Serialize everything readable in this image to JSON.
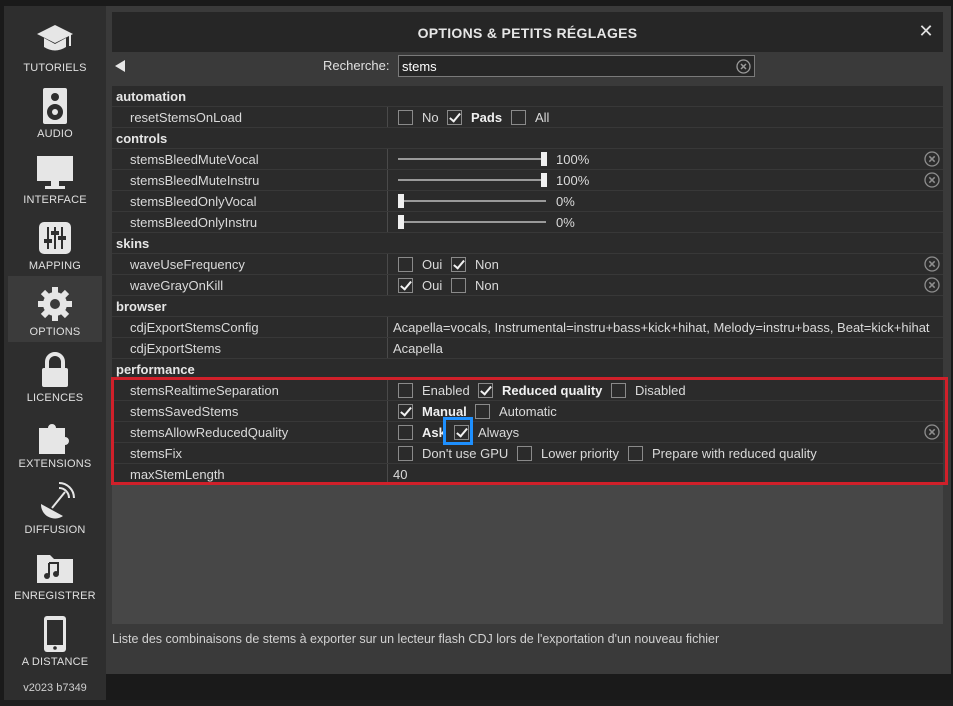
{
  "sidebar": {
    "items": [
      {
        "label": "TUTORIELS",
        "icon": "graduation-cap-icon"
      },
      {
        "label": "AUDIO",
        "icon": "speaker-icon"
      },
      {
        "label": "INTERFACE",
        "icon": "monitor-icon"
      },
      {
        "label": "MAPPING",
        "icon": "sliders-icon"
      },
      {
        "label": "OPTIONS",
        "icon": "gear-icon",
        "active": true
      },
      {
        "label": "LICENCES",
        "icon": "lock-icon"
      },
      {
        "label": "EXTENSIONS",
        "icon": "puzzle-icon"
      },
      {
        "label": "DIFFUSION",
        "icon": "broadcast-icon"
      },
      {
        "label": "ENREGISTRER",
        "icon": "music-folder-icon"
      },
      {
        "label": "A DISTANCE",
        "icon": "phone-icon"
      }
    ],
    "version": "v2023 b7349"
  },
  "dialog": {
    "title": "OPTIONS & PETITS RÉGLAGES",
    "close": "✕",
    "search_label": "Recherche:",
    "search_value": "stems"
  },
  "table": {
    "automation": "automation",
    "resetStemsOnLoad": {
      "name": "resetStemsOnLoad",
      "options": [
        "No",
        "Pads",
        "All"
      ],
      "selected": "Pads"
    },
    "controls": "controls",
    "stemsBleedMuteVocal": {
      "name": "stemsBleedMuteVocal",
      "value": "100%",
      "level": 1.0
    },
    "stemsBleedMuteInstru": {
      "name": "stemsBleedMuteInstru",
      "value": "100%",
      "level": 1.0
    },
    "stemsBleedOnlyVocal": {
      "name": "stemsBleedOnlyVocal",
      "value": "0%",
      "level": 0.0
    },
    "stemsBleedOnlyInstru": {
      "name": "stemsBleedOnlyInstru",
      "value": "0%",
      "level": 0.0
    },
    "skins": "skins",
    "waveUseFrequency": {
      "name": "waveUseFrequency",
      "options": [
        "Oui",
        "Non"
      ],
      "selected": "Non"
    },
    "waveGrayOnKill": {
      "name": "waveGrayOnKill",
      "options": [
        "Oui",
        "Non"
      ],
      "selected": "Oui"
    },
    "browser": "browser",
    "cdjExportStemsConfig": {
      "name": "cdjExportStemsConfig",
      "value": "Acapella=vocals, Instrumental=instru+bass+kick+hihat, Melody=instru+bass, Beat=kick+hihat"
    },
    "cdjExportStems": {
      "name": "cdjExportStems",
      "value": "Acapella"
    },
    "performance": "performance",
    "stemsRealtimeSeparation": {
      "name": "stemsRealtimeSeparation",
      "options": [
        "Enabled",
        "Reduced quality",
        "Disabled"
      ],
      "selected": "Reduced quality"
    },
    "stemsSavedStems": {
      "name": "stemsSavedStems",
      "options": [
        "Manual",
        "Automatic"
      ],
      "selected": "Manual"
    },
    "stemsAllowReducedQuality": {
      "name": "stemsAllowReducedQuality",
      "options": [
        "Ask",
        "Always"
      ],
      "selected": "Always"
    },
    "stemsFix": {
      "name": "stemsFix",
      "options": [
        "Don't use GPU",
        "Lower priority",
        "Prepare with reduced quality"
      ]
    },
    "maxStemLength": {
      "name": "maxStemLength",
      "value": "40"
    }
  },
  "footer": "Liste des combinaisons de stems à exporter sur un lecteur flash CDJ lors de l'exportation d'un nouveau fichier",
  "colors": {
    "highlight": "#d0202a",
    "focus": "#1e90ff",
    "panel": "#3a3a3a"
  }
}
